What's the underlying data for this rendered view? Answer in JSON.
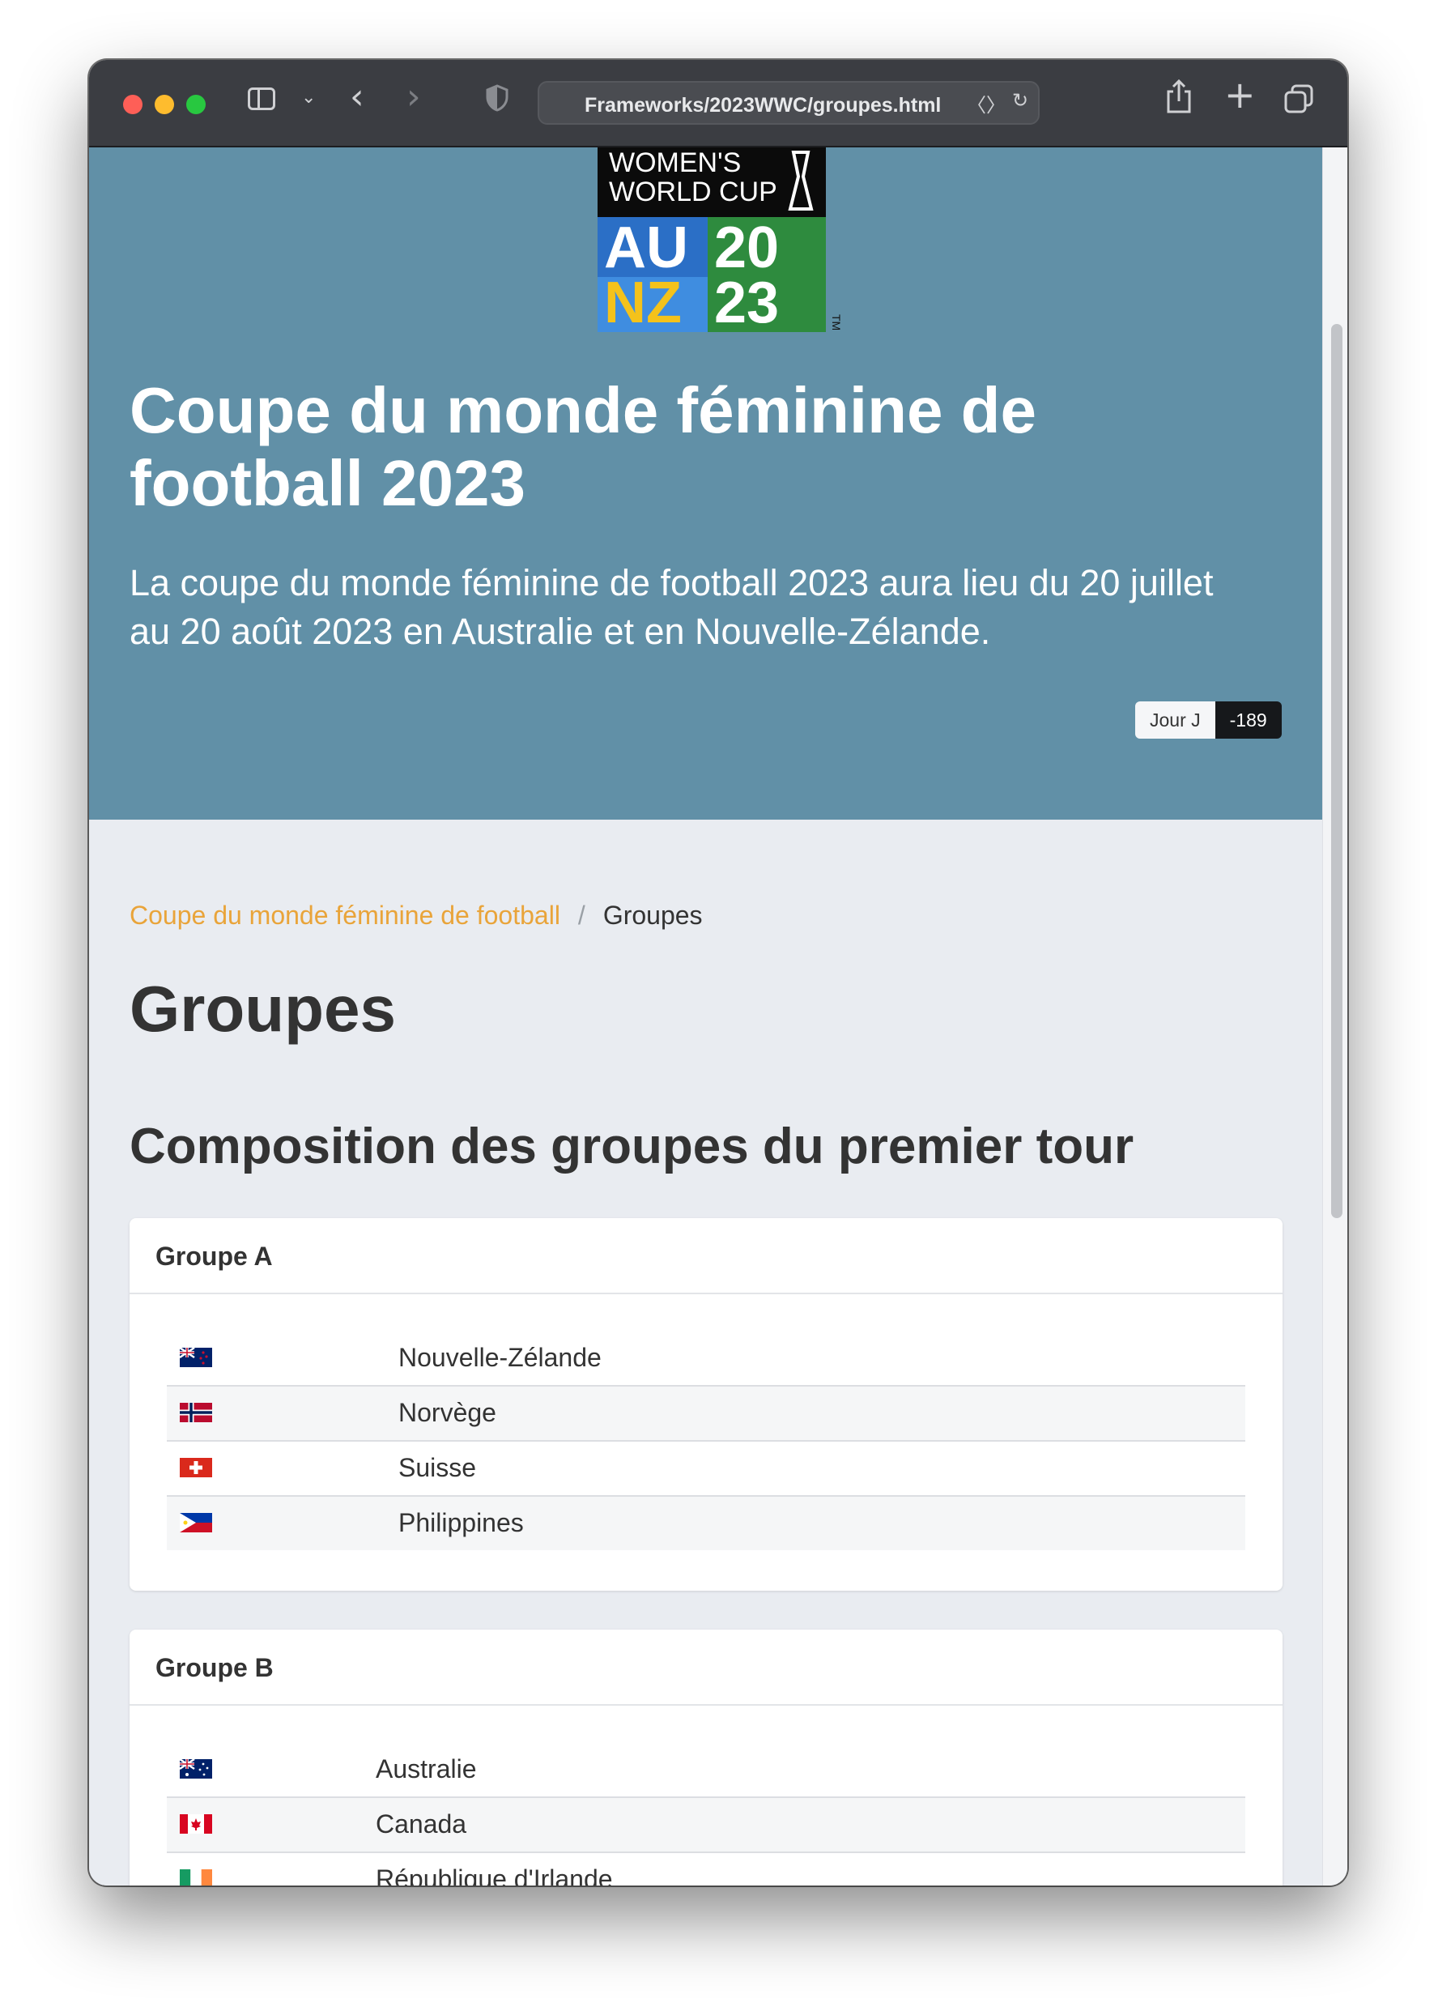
{
  "browser": {
    "url": "Frameworks/2023WWC/groupes.html"
  },
  "logo": {
    "line1": "WOMEN'S",
    "line2": "WORLD CUP",
    "au": "AU",
    "nz": "NZ",
    "year_top": "20",
    "year_bottom": "23",
    "tm": "TM"
  },
  "hero": {
    "title": "Coupe du monde féminine de football 2023",
    "lead": "La coupe du monde féminine de football 2023 aura lieu du 20 juillet au 20 août 2023 en Australie et en Nouvelle-Zélande.",
    "countdown_label": "Jour J",
    "countdown_value": "-189"
  },
  "breadcrumb": {
    "home": "Coupe du monde féminine de football",
    "separator": "/",
    "current": "Groupes"
  },
  "page": {
    "title": "Groupes",
    "section_title": "Composition des groupes du premier tour"
  },
  "groups": [
    {
      "name": "Groupe A",
      "teams": [
        {
          "name": "Nouvelle-Zélande",
          "flag": "new-zealand-flag"
        },
        {
          "name": "Norvège",
          "flag": "norway-flag"
        },
        {
          "name": "Suisse",
          "flag": "switzerland-flag"
        },
        {
          "name": "Philippines",
          "flag": "philippines-flag"
        }
      ]
    },
    {
      "name": "Groupe B",
      "teams": [
        {
          "name": "Australie",
          "flag": "australia-flag"
        },
        {
          "name": "Canada",
          "flag": "canada-flag"
        },
        {
          "name": "République d'Irlande",
          "flag": "ireland-flag"
        }
      ]
    }
  ],
  "colors": {
    "hero_bg": "#6190a7",
    "breadcrumb_link": "#e9a43a",
    "page_bg": "#e9ecf1"
  }
}
